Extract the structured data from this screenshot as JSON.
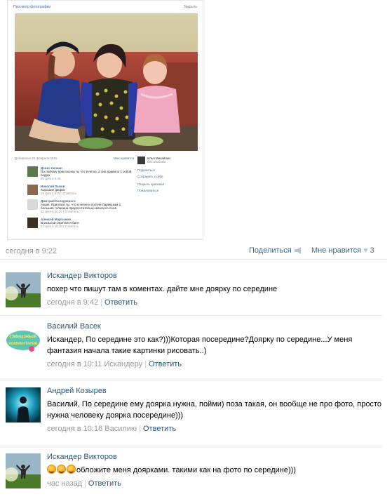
{
  "embedded_screenshot": {
    "header_title": "Просмотр фотографии",
    "close_label": "Закрыть",
    "added_date": "Добавлена 20 февраля 2016",
    "like_label": "Мне нравится",
    "owner_name": "Илья Михайлин",
    "owner_sub": "без альбома",
    "side_actions": [
      "Поделиться",
      "Сохранить к себе",
      "Открыть оригинал",
      "Пожаловаться"
    ],
    "comments": [
      {
        "name": "Денис Калкин",
        "text": "По любому пригласили ты что в нетке, а она правило с собой подруг",
        "date": "20 фев в 0:46"
      },
      {
        "name": "Николай Львов",
        "text": "Хорошие дворки",
        "date": "20 фев в 5:03 | Ответить"
      },
      {
        "name": "Дмитрий Колодзяного",
        "text": "Акция. Пригласи ты, что в нетке и получи Ларевском 2 большие толанина предпочтительно женского пола",
        "date": "21 фев в 20:27 | Ответить"
      },
      {
        "name": "Алексей Мартынов",
        "text": "В розыски спрятался батя",
        "date": "21 фев в 16:20 | Ответить"
      }
    ]
  },
  "post_meta": {
    "date": "сегодня в 9:22",
    "share_label": "Поделиться",
    "like_label": "Мне нравится",
    "like_count": "3"
  },
  "comments": [
    {
      "author": "Искандер Викторов",
      "text": "похер что пишут там в коментах. дайте мне доярку по середине",
      "time": "сегодня в 9:42",
      "reply_to": "",
      "reply_label": "Ответить"
    },
    {
      "author": "Василий Васек",
      "text": "Искандер, По середине это как?)))Которая посередине?Доярку по середине...У меня фантазия начала такие картинки рисовать..)",
      "time": "сегодня в 10:11",
      "reply_to": "Искандеру",
      "reply_label": "Ответить",
      "avatar_text": "СМЕШНЫЕ КОММЕНТАРИИ"
    },
    {
      "author": "Андрей Козырев",
      "text": "Василий, По середине ему доярка нужна, пойми) поза такая, он вообще не про фото, просто нужна человеку доярка посередине)))",
      "time": "сегодня в 10:18",
      "reply_to": "Василию",
      "reply_label": "Ответить"
    },
    {
      "author": "Искандер Викторов",
      "text": "обложите меня доярками. такими как на фото по середине)))",
      "time": "час назад",
      "reply_to": "",
      "reply_label": "Ответить"
    }
  ]
}
